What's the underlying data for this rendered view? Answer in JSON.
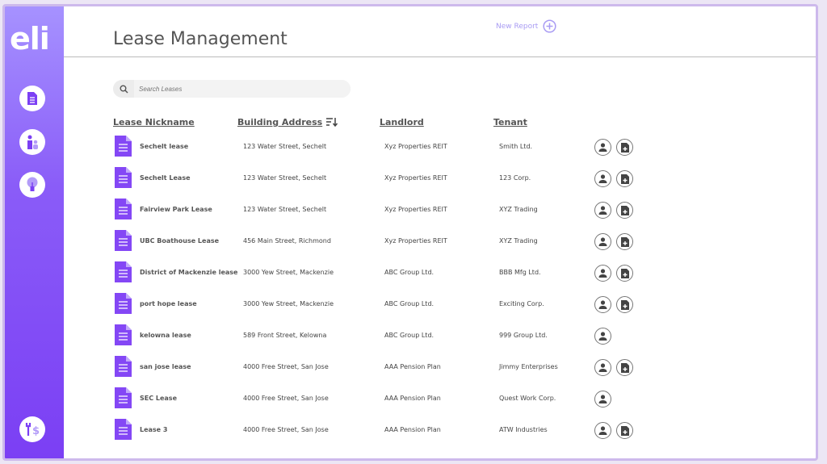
{
  "app": {
    "logo": "eli",
    "title": "Lease Management",
    "new_report": "New Report"
  },
  "search": {
    "placeholder": "Search Leases"
  },
  "columns": [
    "Lease Nickname",
    "Building Address",
    "Landlord",
    "Tenant"
  ],
  "rows": [
    {
      "name": "Sechelt lease",
      "address": "123 Water Street, Sechelt",
      "landlord": "Xyz Properties REIT",
      "tenant": "Smith Ltd.",
      "has_doc": true
    },
    {
      "name": "Sechelt Lease",
      "address": "123 Water Street, Sechelt",
      "landlord": "Xyz Properties REIT",
      "tenant": "123 Corp.",
      "has_doc": true
    },
    {
      "name": "Fairview Park Lease",
      "address": "123 Water Street, Sechelt",
      "landlord": "Xyz Properties REIT",
      "tenant": "XYZ Trading",
      "has_doc": true
    },
    {
      "name": "UBC Boathouse Lease",
      "address": "456 Main Street, Richmond",
      "landlord": "Xyz Properties REIT",
      "tenant": "XYZ Trading",
      "has_doc": true
    },
    {
      "name": "District of Mackenzie lease",
      "address": "3000 Yew Street, Mackenzie",
      "landlord": "ABC Group Ltd.",
      "tenant": "BBB Mfg Ltd.",
      "has_doc": true
    },
    {
      "name": "port hope lease",
      "address": "3000 Yew Street, Mackenzie",
      "landlord": "ABC Group Ltd.",
      "tenant": "Exciting Corp.",
      "has_doc": true
    },
    {
      "name": "kelowna lease",
      "address": "589 Front Street, Kelowna",
      "landlord": "ABC Group Ltd.",
      "tenant": "999 Group Ltd.",
      "has_doc": false
    },
    {
      "name": "san jose lease",
      "address": "4000 Free Street, San Jose",
      "landlord": "AAA Pension Plan",
      "tenant": "Jimmy Enterprises",
      "has_doc": true
    },
    {
      "name": "SEC Lease",
      "address": "4000 Free Street, San Jose",
      "landlord": "AAA Pension Plan",
      "tenant": "Quest Work Corp.",
      "has_doc": false
    },
    {
      "name": "Lease 3",
      "address": "4000 Free Street, San Jose",
      "landlord": "AAA Pension Plan",
      "tenant": "ATW Industries",
      "has_doc": true
    }
  ],
  "colors": {
    "accent": "#7b3ff4",
    "link": "#a99cf3"
  }
}
